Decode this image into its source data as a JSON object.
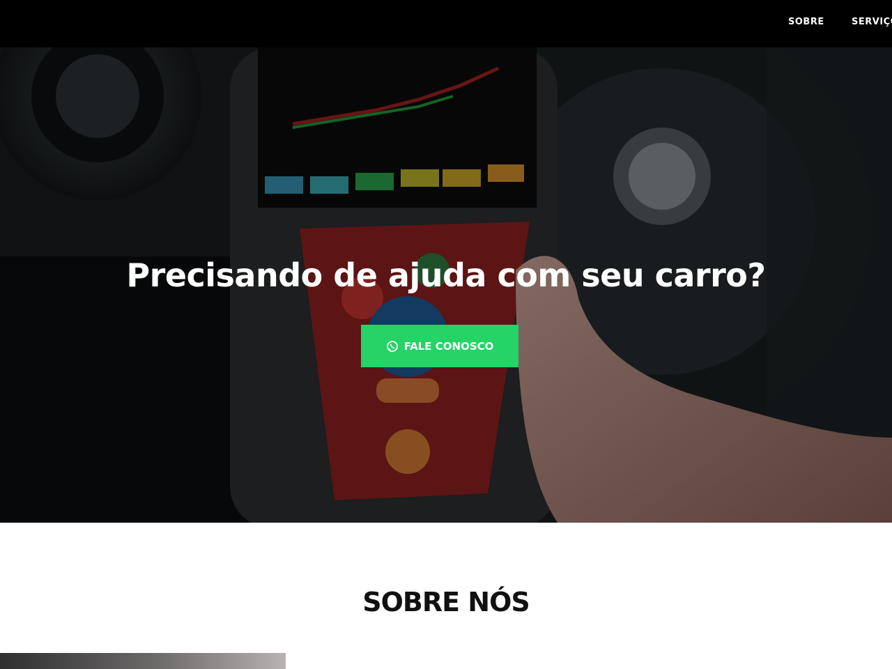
{
  "nav": {
    "items": [
      {
        "label": "SOBRE"
      },
      {
        "label": "SERVIÇOS"
      }
    ]
  },
  "hero": {
    "title": "Precisando de ajuda com seu carro?",
    "cta_label": "FALE CONOSCO",
    "cta_icon": "whatsapp-icon",
    "cta_color": "#25d366"
  },
  "about": {
    "title": "SOBRE NÓS"
  },
  "colors": {
    "nav_bg": "#000000",
    "accent": "#25d366",
    "page_bg": "#ffffff"
  }
}
